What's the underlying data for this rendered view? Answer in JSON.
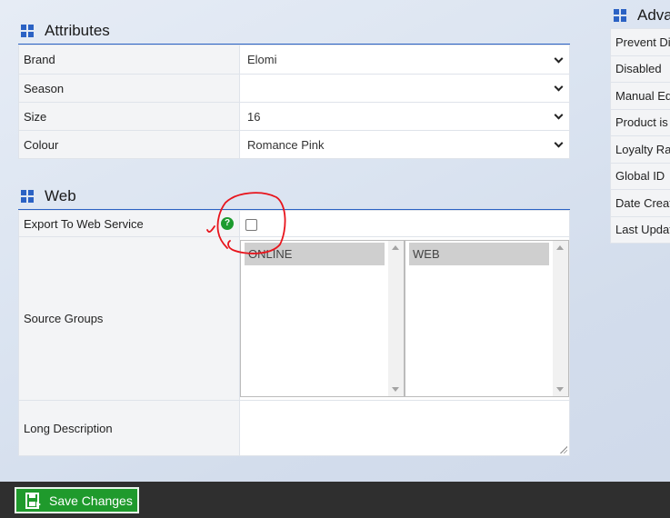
{
  "attributes": {
    "title": "Attributes",
    "rows": [
      {
        "label": "Brand",
        "value": "Elomi"
      },
      {
        "label": "Season",
        "value": ""
      },
      {
        "label": "Size",
        "value": "16"
      },
      {
        "label": "Colour",
        "value": "Romance Pink"
      }
    ]
  },
  "web": {
    "title": "Web",
    "export_label": "Export To Web Service",
    "help_icon_glyph": "?",
    "export_checked": false,
    "source_groups_label": "Source Groups",
    "source_groups_available": [
      "ONLINE"
    ],
    "source_groups_selected": [
      "WEB"
    ],
    "long_description_label": "Long Description",
    "long_description_value": ""
  },
  "advanced": {
    "title": "Adva",
    "rows": [
      "Prevent Di",
      "Disabled",
      "Manual Ed",
      "Product is",
      "Loyalty Ra",
      "Global ID",
      "Date Creat",
      "Last Updat"
    ]
  },
  "footer": {
    "save_label": "Save Changes"
  },
  "colors": {
    "accent": "#2b62c4",
    "save_button": "#1f9a2c",
    "help_icon": "#1d9b2f",
    "footer_bg": "#2f2f2f",
    "annotation": "#e8141c"
  },
  "icons": {
    "section": "grid-icon",
    "help": "help-icon",
    "save": "save-icon"
  }
}
